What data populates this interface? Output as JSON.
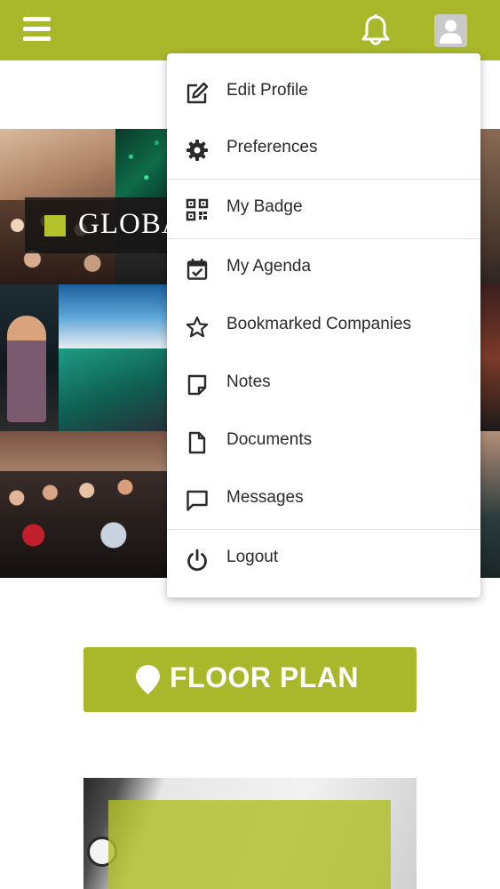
{
  "header": {
    "background_color": "#a9b82a",
    "menu_icon": "hamburger-menu-icon",
    "notification_icon": "bell-icon",
    "profile_icon": "user-avatar-icon"
  },
  "hero": {
    "banner_text": "GLOBA",
    "accent_color": "#b5c22a"
  },
  "floor_plan": {
    "label": "FLOOR PLAN",
    "icon": "map-pin-icon",
    "color": "#a9b82a"
  },
  "user_menu": {
    "items": [
      {
        "label": "Edit Profile",
        "icon": "edit-icon"
      },
      {
        "label": "Preferences",
        "icon": "gear-icon"
      },
      {
        "label": "My Badge",
        "icon": "qr-code-icon"
      },
      {
        "label": "My Agenda",
        "icon": "calendar-check-icon"
      },
      {
        "label": "Bookmarked Companies",
        "icon": "star-icon"
      },
      {
        "label": "Notes",
        "icon": "note-icon"
      },
      {
        "label": "Documents",
        "icon": "document-icon"
      },
      {
        "label": "Messages",
        "icon": "message-icon"
      },
      {
        "label": "Logout",
        "icon": "power-icon"
      }
    ]
  }
}
